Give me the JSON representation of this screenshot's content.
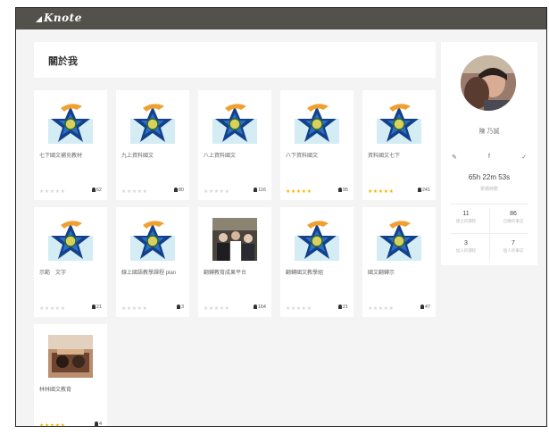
{
  "header": {
    "logo_text": "Knote"
  },
  "page": {
    "title": "關於我"
  },
  "courses": [
    {
      "title": "七下國文補充教材",
      "thumb": "star",
      "rating": 0,
      "count": "62"
    },
    {
      "title": "九上資料國文",
      "thumb": "star",
      "rating": 0,
      "count": "80"
    },
    {
      "title": "八上資料國文",
      "thumb": "star",
      "rating": 0,
      "count": "116"
    },
    {
      "title": "八下資料國文",
      "thumb": "star",
      "rating": 5,
      "count": "95"
    },
    {
      "title": "資料國文七下",
      "thumb": "star",
      "rating": 5,
      "count": "241"
    },
    {
      "title": "示範　文字",
      "thumb": "star",
      "rating": 0,
      "count": "21"
    },
    {
      "title": "線上國語教學課程 plan",
      "thumb": "star",
      "rating": 0,
      "count": "3"
    },
    {
      "title": "翻轉教育成果平台",
      "thumb": "photo-classroom",
      "rating": 0,
      "count": "164"
    },
    {
      "title": "翻轉國文教學組",
      "thumb": "star",
      "rating": 0,
      "count": "21"
    },
    {
      "title": "國文翻轉示",
      "thumb": "star",
      "rating": 0,
      "count": "47"
    },
    {
      "title": "林林國文教育",
      "thumb": "photo-desk",
      "rating": 5,
      "count": "4"
    }
  ],
  "profile": {
    "name": "陳 乃誠",
    "social_icons": [
      "pencil-icon",
      "facebook-icon",
      "twitter-icon"
    ],
    "uptime_value": "65h 22m 53s",
    "uptime_label": "累積時數",
    "stats": [
      {
        "value": "11",
        "label": "建立的課程"
      },
      {
        "value": "86",
        "label": "已購的筆記"
      },
      {
        "value": "3",
        "label": "加入的課程"
      },
      {
        "value": "7",
        "label": "個人的筆記"
      }
    ]
  },
  "colors": {
    "topbar": "#52514b",
    "star_on": "#f4b400",
    "star_off": "#d7d7d7"
  }
}
